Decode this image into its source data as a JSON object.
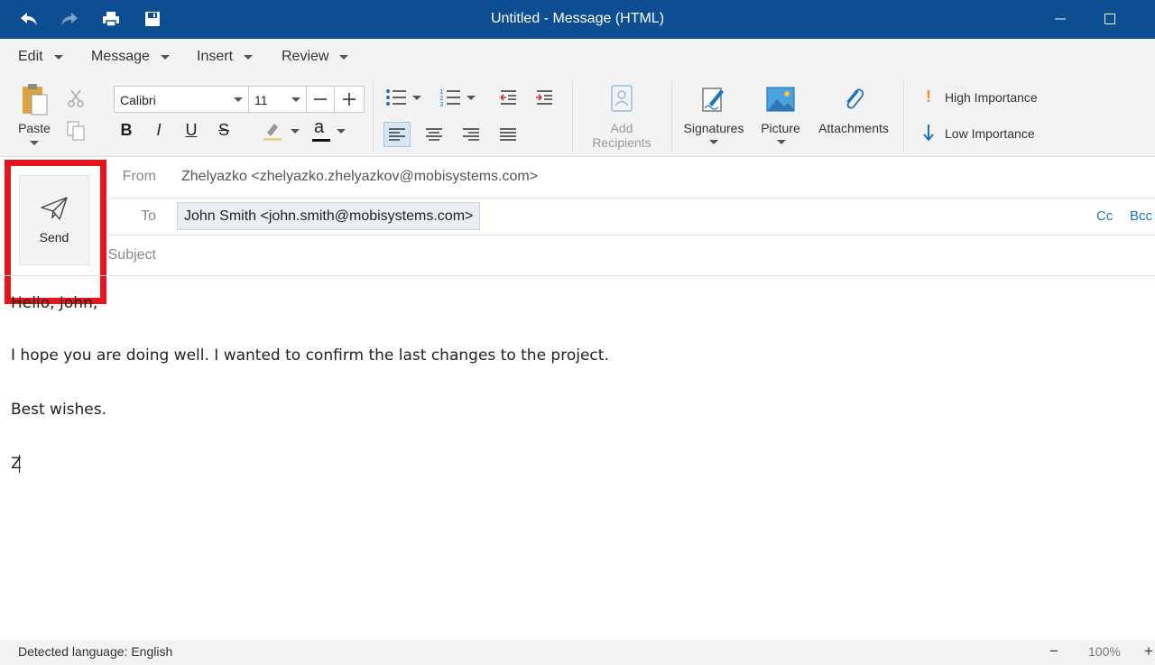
{
  "window": {
    "title": "Untitled - Message (HTML)",
    "title_bar_color": "#0d4d91"
  },
  "quick_access": {
    "undo_icon": "undo-icon",
    "redo_icon": "redo-icon",
    "print_icon": "print-icon",
    "save_icon": "save-icon"
  },
  "menu": {
    "items": [
      {
        "label": "Edit"
      },
      {
        "label": "Message"
      },
      {
        "label": "Insert"
      },
      {
        "label": "Review"
      }
    ]
  },
  "ribbon": {
    "paste_label": "Paste",
    "font_name": "Calibri",
    "font_size": "11",
    "bold": "B",
    "italic": "I",
    "underline": "U",
    "strike": "S",
    "font_color_letter": "a",
    "add_recipients_line1": "Add",
    "add_recipients_line2": "Recipients",
    "signatures_label": "Signatures",
    "picture_label": "Picture",
    "attachments_label": "Attachments",
    "high_importance_label": "High Importance",
    "low_importance_label": "Low Importance",
    "accent_color": "#1e73be",
    "high_importance_color": "#f08a24"
  },
  "compose": {
    "send_label": "Send",
    "from_label": "From",
    "from_value": "Zhelyazko <zhelyazko.zhelyazkov@mobisystems.com>",
    "to_label": "To",
    "to_recipient": "John Smith <john.smith@mobisystems.com>",
    "cc_label": "Cc",
    "bcc_label": "Bcc",
    "subject_label": "Subject",
    "subject_value": "",
    "highlight_color": "#e8141c"
  },
  "body": {
    "lines": [
      "Hello, John,",
      "I hope you are doing well. I wanted to confirm the last changes to the project.",
      "Best wishes.",
      "Z"
    ]
  },
  "status": {
    "language": "Detected language: English",
    "zoom_out": "−",
    "zoom": "100%",
    "zoom_in": "+"
  }
}
